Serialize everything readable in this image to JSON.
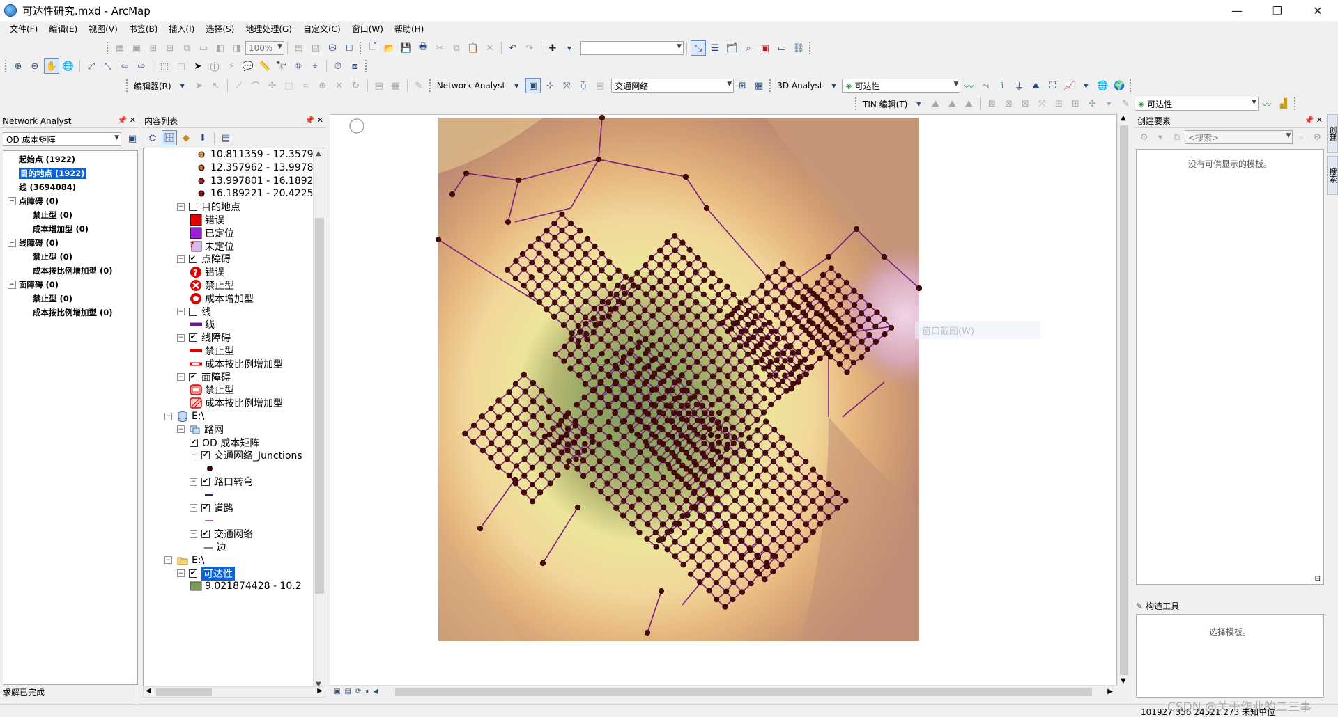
{
  "window": {
    "title": "可达性研究.mxd - ArcMap",
    "controls": [
      "—",
      "❐",
      "✕"
    ]
  },
  "menu": [
    "文件(F)",
    "编辑(E)",
    "视图(V)",
    "书签(B)",
    "插入(I)",
    "选择(S)",
    "地理处理(G)",
    "自定义(C)",
    "窗口(W)",
    "帮助(H)"
  ],
  "toolbar": {
    "zoom_value": "100%",
    "editor_label": "编辑器(R)",
    "network_analyst_label": "Network Analyst",
    "network_dataset": "交通网络",
    "analyst3d_label": "3D Analyst",
    "analyst3d_layer": "可达性",
    "tin_label": "TIN 编辑(T)",
    "right_layer": "可达性"
  },
  "network_analyst": {
    "header": "Network Analyst",
    "analysis_layer": "OD 成本矩阵",
    "items": [
      {
        "label": "起始点 (1922)",
        "level": 0,
        "expander": "",
        "selected": false
      },
      {
        "label": "目的地点 (1922)",
        "level": 0,
        "expander": "",
        "selected": true
      },
      {
        "label": "线 (3694084)",
        "level": 0,
        "expander": "",
        "selected": false
      },
      {
        "label": "点障碍 (0)",
        "level": 0,
        "expander": "−",
        "selected": false
      },
      {
        "label": "禁止型 (0)",
        "level": 1,
        "expander": "",
        "selected": false
      },
      {
        "label": "成本增加型 (0)",
        "level": 1,
        "expander": "",
        "selected": false
      },
      {
        "label": "线障碍 (0)",
        "level": 0,
        "expander": "−",
        "selected": false
      },
      {
        "label": "禁止型 (0)",
        "level": 1,
        "expander": "",
        "selected": false
      },
      {
        "label": "成本按比例增加型 (0)",
        "level": 1,
        "expander": "",
        "selected": false
      },
      {
        "label": "面障碍 (0)",
        "level": 0,
        "expander": "−",
        "selected": false
      },
      {
        "label": "禁止型 (0)",
        "level": 1,
        "expander": "",
        "selected": false
      },
      {
        "label": "成本按比例增加型 (0)",
        "level": 1,
        "expander": "",
        "selected": false
      }
    ],
    "status": "求解已完成"
  },
  "toc": {
    "header": "内容列表",
    "rows": [
      {
        "label": "10.811359 - 12.3579",
        "indent": 74,
        "exp": "",
        "chk": "",
        "sym": "dot-orange",
        "selected": false
      },
      {
        "label": "12.357962 - 13.9978",
        "indent": 74,
        "exp": "",
        "chk": "",
        "sym": "dot-orange2",
        "selected": false
      },
      {
        "label": "13.997801 - 16.1892",
        "indent": 74,
        "exp": "",
        "chk": "",
        "sym": "dot-red",
        "selected": false
      },
      {
        "label": "16.189221 - 20.4225",
        "indent": 74,
        "exp": "",
        "chk": "",
        "sym": "dot-darkred",
        "selected": false
      },
      {
        "label": "目的地点",
        "indent": 48,
        "exp": "−",
        "chk": "empty",
        "sym": "",
        "selected": false
      },
      {
        "label": "错误",
        "indent": 66,
        "exp": "",
        "chk": "",
        "sym": "sq-red",
        "selected": false
      },
      {
        "label": "已定位",
        "indent": 66,
        "exp": "",
        "chk": "",
        "sym": "sq-purple",
        "selected": false
      },
      {
        "label": "未定位",
        "indent": 66,
        "exp": "",
        "chk": "",
        "sym": "sq-lilac",
        "selected": false
      },
      {
        "label": "点障碍",
        "indent": 48,
        "exp": "−",
        "chk": "checked",
        "sym": "",
        "selected": false
      },
      {
        "label": "错误",
        "indent": 66,
        "exp": "",
        "chk": "",
        "sym": "bar-error",
        "selected": false
      },
      {
        "label": "禁止型",
        "indent": 66,
        "exp": "",
        "chk": "",
        "sym": "bar-x",
        "selected": false
      },
      {
        "label": "成本增加型",
        "indent": 66,
        "exp": "",
        "chk": "",
        "sym": "bar-ring",
        "selected": false
      },
      {
        "label": "线",
        "indent": 48,
        "exp": "−",
        "chk": "empty",
        "sym": "",
        "selected": false
      },
      {
        "label": "线",
        "indent": 66,
        "exp": "",
        "chk": "",
        "sym": "line-purple",
        "selected": false
      },
      {
        "label": "线障碍",
        "indent": 48,
        "exp": "−",
        "chk": "checked",
        "sym": "",
        "selected": false
      },
      {
        "label": "禁止型",
        "indent": 66,
        "exp": "",
        "chk": "",
        "sym": "line-red",
        "selected": false
      },
      {
        "label": "成本按比例增加型",
        "indent": 66,
        "exp": "",
        "chk": "",
        "sym": "line-redhollow",
        "selected": false
      },
      {
        "label": "面障碍",
        "indent": 48,
        "exp": "−",
        "chk": "checked",
        "sym": "",
        "selected": false
      },
      {
        "label": "禁止型",
        "indent": 66,
        "exp": "",
        "chk": "",
        "sym": "poly-red",
        "selected": false
      },
      {
        "label": "成本按比例增加型",
        "indent": 66,
        "exp": "",
        "chk": "",
        "sym": "poly-hatch",
        "selected": false
      },
      {
        "label": "E:\\",
        "indent": 30,
        "exp": "−",
        "chk": "",
        "sym": "db",
        "selected": false
      },
      {
        "label": "路网",
        "indent": 48,
        "exp": "−",
        "chk": "",
        "sym": "dataset",
        "selected": false
      },
      {
        "label": "OD 成本矩阵",
        "indent": 66,
        "exp": "",
        "chk": "checked",
        "sym": "",
        "selected": false
      },
      {
        "label": "交通网络_Junctions",
        "indent": 66,
        "exp": "−",
        "chk": "checked",
        "sym": "",
        "selected": false
      },
      {
        "label": "",
        "indent": 86,
        "exp": "",
        "chk": "",
        "sym": "dot-brown",
        "selected": false
      },
      {
        "label": "路口转弯",
        "indent": 66,
        "exp": "−",
        "chk": "checked",
        "sym": "",
        "selected": false
      },
      {
        "label": "",
        "indent": 86,
        "exp": "",
        "chk": "",
        "sym": "line-navy",
        "selected": false
      },
      {
        "label": "道路",
        "indent": 66,
        "exp": "−",
        "chk": "checked",
        "sym": "",
        "selected": false
      },
      {
        "label": "",
        "indent": 86,
        "exp": "",
        "chk": "",
        "sym": "line-purple-thin",
        "selected": false
      },
      {
        "label": "交通网络",
        "indent": 66,
        "exp": "−",
        "chk": "checked",
        "sym": "",
        "selected": false
      },
      {
        "label": "— 边",
        "indent": 86,
        "exp": "",
        "chk": "",
        "sym": "",
        "selected": false
      },
      {
        "label": "E:\\",
        "indent": 30,
        "exp": "−",
        "chk": "",
        "sym": "folder",
        "selected": false
      },
      {
        "label": "可达性",
        "indent": 48,
        "exp": "−",
        "chk": "checked",
        "sym": "",
        "selected": true
      },
      {
        "label": "9.021874428 - 10.2",
        "indent": 66,
        "exp": "",
        "chk": "",
        "sym": "sq-green",
        "selected": false
      }
    ]
  },
  "create_features": {
    "header": "创建要素",
    "search_placeholder": "<搜索>",
    "empty_msg": "没有可供显示的模板。",
    "tools_header": "构造工具",
    "tools_msg": "选择模板。",
    "side_tabs": [
      "创建",
      "搜索"
    ]
  },
  "map": {
    "ghost_text": "窗口截图(W)"
  },
  "status": {
    "coords": "101927.356  24521.273 未知单位",
    "watermark": "CSDN @关于作业的二三事"
  },
  "colors": {
    "selection": "#0a64d8",
    "road": "#7b1d7e",
    "junction": "#4a0a0a"
  }
}
